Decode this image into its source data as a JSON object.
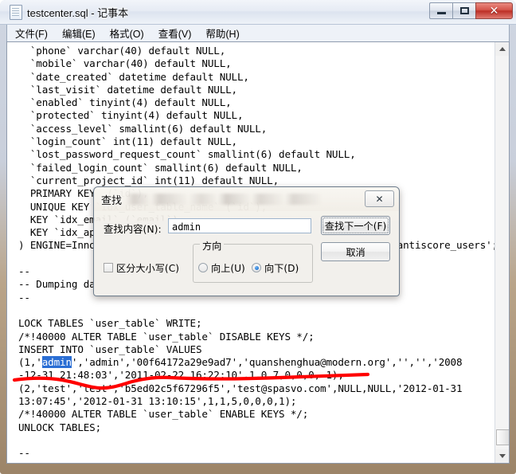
{
  "window": {
    "title": "testcenter.sql - 记事本",
    "icon": "notepad-icon",
    "buttons": {
      "minimize": "最小化",
      "maximize": "最大化",
      "close": "✕"
    }
  },
  "menu": {
    "items": [
      {
        "label": "文件(F)",
        "key": "F"
      },
      {
        "label": "编辑(E)",
        "key": "E"
      },
      {
        "label": "格式(O)",
        "key": "O"
      },
      {
        "label": "查看(V)",
        "key": "V"
      },
      {
        "label": "帮助(H)",
        "key": "H"
      }
    ]
  },
  "editor": {
    "lines_before_selection": "  `phone` varchar(40) default NULL,\n  `mobile` varchar(40) default NULL,\n  `date_created` datetime default NULL,\n  `last_visit` datetime default NULL,\n  `enabled` tinyint(4) default NULL,\n  `protected` tinyint(4) default NULL,\n  `access_level` smallint(6) default NULL,\n  `login_count` int(11) default NULL,\n  `lost_password_request_count` smallint(6) default NULL,\n  `failed_login_count` smallint(6) default NULL,\n  `current_project_id` int(11) default NULL,\n  PRIMARY KEY  (`id`),\n  UNIQUE KEY `idx_user_table_name` (`id`),\n  KEY `idx_email` (`email`),\n  KEY `idx_api_key` (`api_key`)\n) ENGINE=InnoDB AUTO_INCREMENT=3 DEFAULT CHARSET=utf8 COMMENT='mantiscore_users';\n\n--\n-- Dumping data for table `user_table`\n--\n\nLOCK TABLES `user_table` WRITE;\n/*!40000 ALTER TABLE `user_table` DISABLE KEYS */;\nINSERT INTO `user_table` VALUES\n(1,'",
    "selected_text": "admin",
    "lines_after_selection": "','admin','00f64172a29e9ad7','quanshenghua@modern.org','','','2008\n-12-31 21:48:03','2011-02-22 16:22:10',1,0,7,0,0,0,-1),\n(2,'test','test','b5ed02c5f67296f5','test@spasvo.com',NULL,NULL,'2012-01-31\n13:07:45','2012-01-31 13:10:15',1,1,5,0,0,0,1);\n/*!40000 ALTER TABLE `user_table` ENABLE KEYS */;\nUNLOCK TABLES;\n\n--",
    "selection_color": "#2a6ed4",
    "annotation_color": "#ff0000"
  },
  "scrollbar": {
    "up_arrow": "▲",
    "down_arrow": "▼"
  },
  "find_dialog": {
    "title": "查找",
    "close_label": "✕",
    "search_label": "查找内容(N):",
    "search_value": "admin",
    "search_placeholder": "",
    "find_next_label": "查找下一个(F)",
    "cancel_label": "取消",
    "match_case_label": "区分大小写(C)",
    "match_case_checked": false,
    "direction_group_label": "方向",
    "direction_up_label": "向上(U)",
    "direction_down_label": "向下(D)",
    "direction_selected": "向下(D)",
    "accent_color": "#0c62c4"
  }
}
